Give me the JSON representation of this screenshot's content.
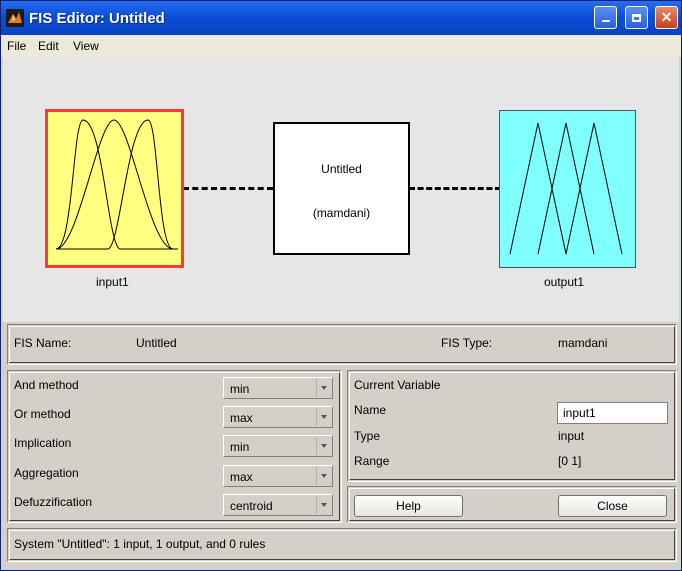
{
  "window": {
    "title": "FIS Editor: Untitled"
  },
  "menu": [
    "File",
    "Edit",
    "View"
  ],
  "diagram": {
    "input_label": "input1",
    "output_label": "output1",
    "system_name": "Untitled",
    "system_type": "(mamdani)"
  },
  "fis": {
    "name_label": "FIS Name:",
    "name_value": "Untitled",
    "type_label": "FIS Type:",
    "type_value": "mamdani"
  },
  "methods": [
    {
      "label": "And method",
      "value": "min"
    },
    {
      "label": "Or method",
      "value": "max"
    },
    {
      "label": "Implication",
      "value": "min"
    },
    {
      "label": "Aggregation",
      "value": "max"
    },
    {
      "label": "Defuzzification",
      "value": "centroid"
    }
  ],
  "current_variable": {
    "header": "Current Variable",
    "name_label": "Name",
    "name_value": "input1",
    "type_label": "Type",
    "type_value": "input",
    "range_label": "Range",
    "range_value": "[0 1]"
  },
  "buttons": {
    "help": "Help",
    "close": "Close"
  },
  "status": "System \"Untitled\": 1 input, 1 output, and 0 rules",
  "colors": {
    "input_fill": "#ffff80",
    "input_border": "#ff3b30",
    "output_fill": "#80ffff",
    "titlebar": "#0b4fd8"
  }
}
